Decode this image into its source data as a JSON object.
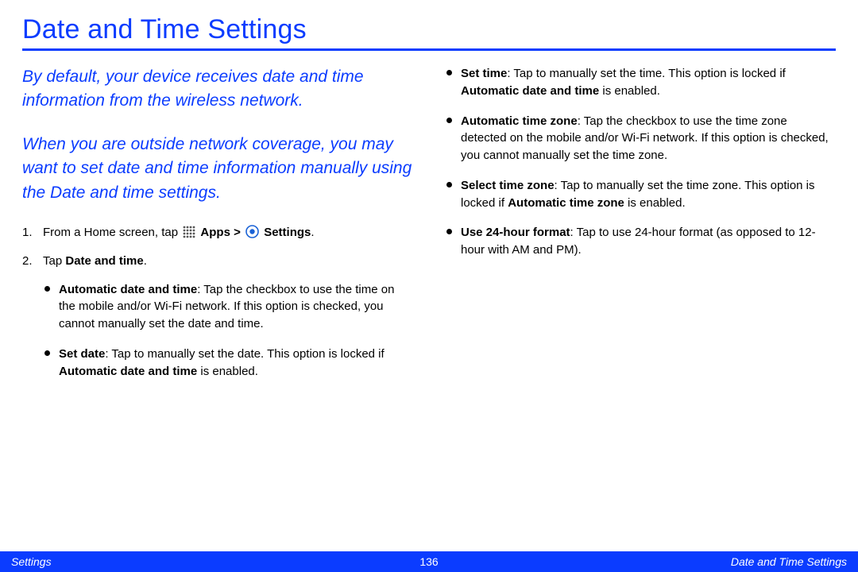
{
  "title": "Date and Time Settings",
  "intro": {
    "p1": "By default, your device receives date and time information from the wireless network.",
    "p2": "When you are outside network coverage, you may want to set date and time information manually using the Date and time settings."
  },
  "steps": {
    "s1_prefix": "From a Home screen, tap ",
    "s1_apps": "Apps",
    "s1_gt": " > ",
    "s1_settings": "Settings",
    "s1_suffix": ".",
    "s2_prefix": "Tap ",
    "s2_bold": "Date and time",
    "s2_suffix": "."
  },
  "bullets_left": [
    {
      "bold1": "Automatic date and time",
      "text1": ": Tap the checkbox to use the time on the mobile and/or Wi-Fi network. If this option is checked, you cannot manually set the date and time."
    },
    {
      "bold1": "Set date",
      "text1": ": Tap to manually set the date. This option is locked if ",
      "bold2": "Automatic date and time",
      "text2": " is enabled."
    }
  ],
  "bullets_right": [
    {
      "bold1": "Set time",
      "text1": ": Tap to manually set the time. This option is locked if ",
      "bold2": "Automatic date and time",
      "text2": " is enabled."
    },
    {
      "bold1": "Automatic time zone",
      "text1": ": Tap the checkbox to use the time zone detected on the mobile and/or Wi-Fi network. If this option is checked, you cannot manually set the time zone."
    },
    {
      "bold1": "Select time zone",
      "text1": ": Tap to manually set the time zone. This option is locked if ",
      "bold2": "Automatic time zone",
      "text2": " is enabled."
    },
    {
      "bold1": "Use 24-hour format",
      "text1": ": Tap to use 24-hour format (as opposed to 12-hour with AM and PM)."
    }
  ],
  "footer": {
    "left": "Settings",
    "center": "136",
    "right": "Date and Time Settings"
  }
}
